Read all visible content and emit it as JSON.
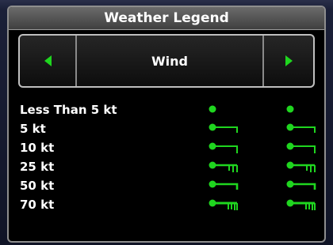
{
  "window": {
    "title": "Weather Legend"
  },
  "selector": {
    "value": "Wind",
    "left_icon": "left-arrow-icon",
    "right_icon": "right-arrow-icon"
  },
  "legend": {
    "rows": [
      {
        "label": "Less Than 5 kt",
        "symbol": "calm"
      },
      {
        "label": " 5 kt",
        "symbol": "5"
      },
      {
        "label": "10 kt",
        "symbol": "10"
      },
      {
        "label": "25 kt",
        "symbol": "25"
      },
      {
        "label": "50 kt",
        "symbol": "50"
      },
      {
        "label": "70 kt",
        "symbol": "70"
      }
    ]
  },
  "colors": {
    "accent": "#1fd61f",
    "window_bg": "#000000",
    "text": "#ffffff"
  }
}
